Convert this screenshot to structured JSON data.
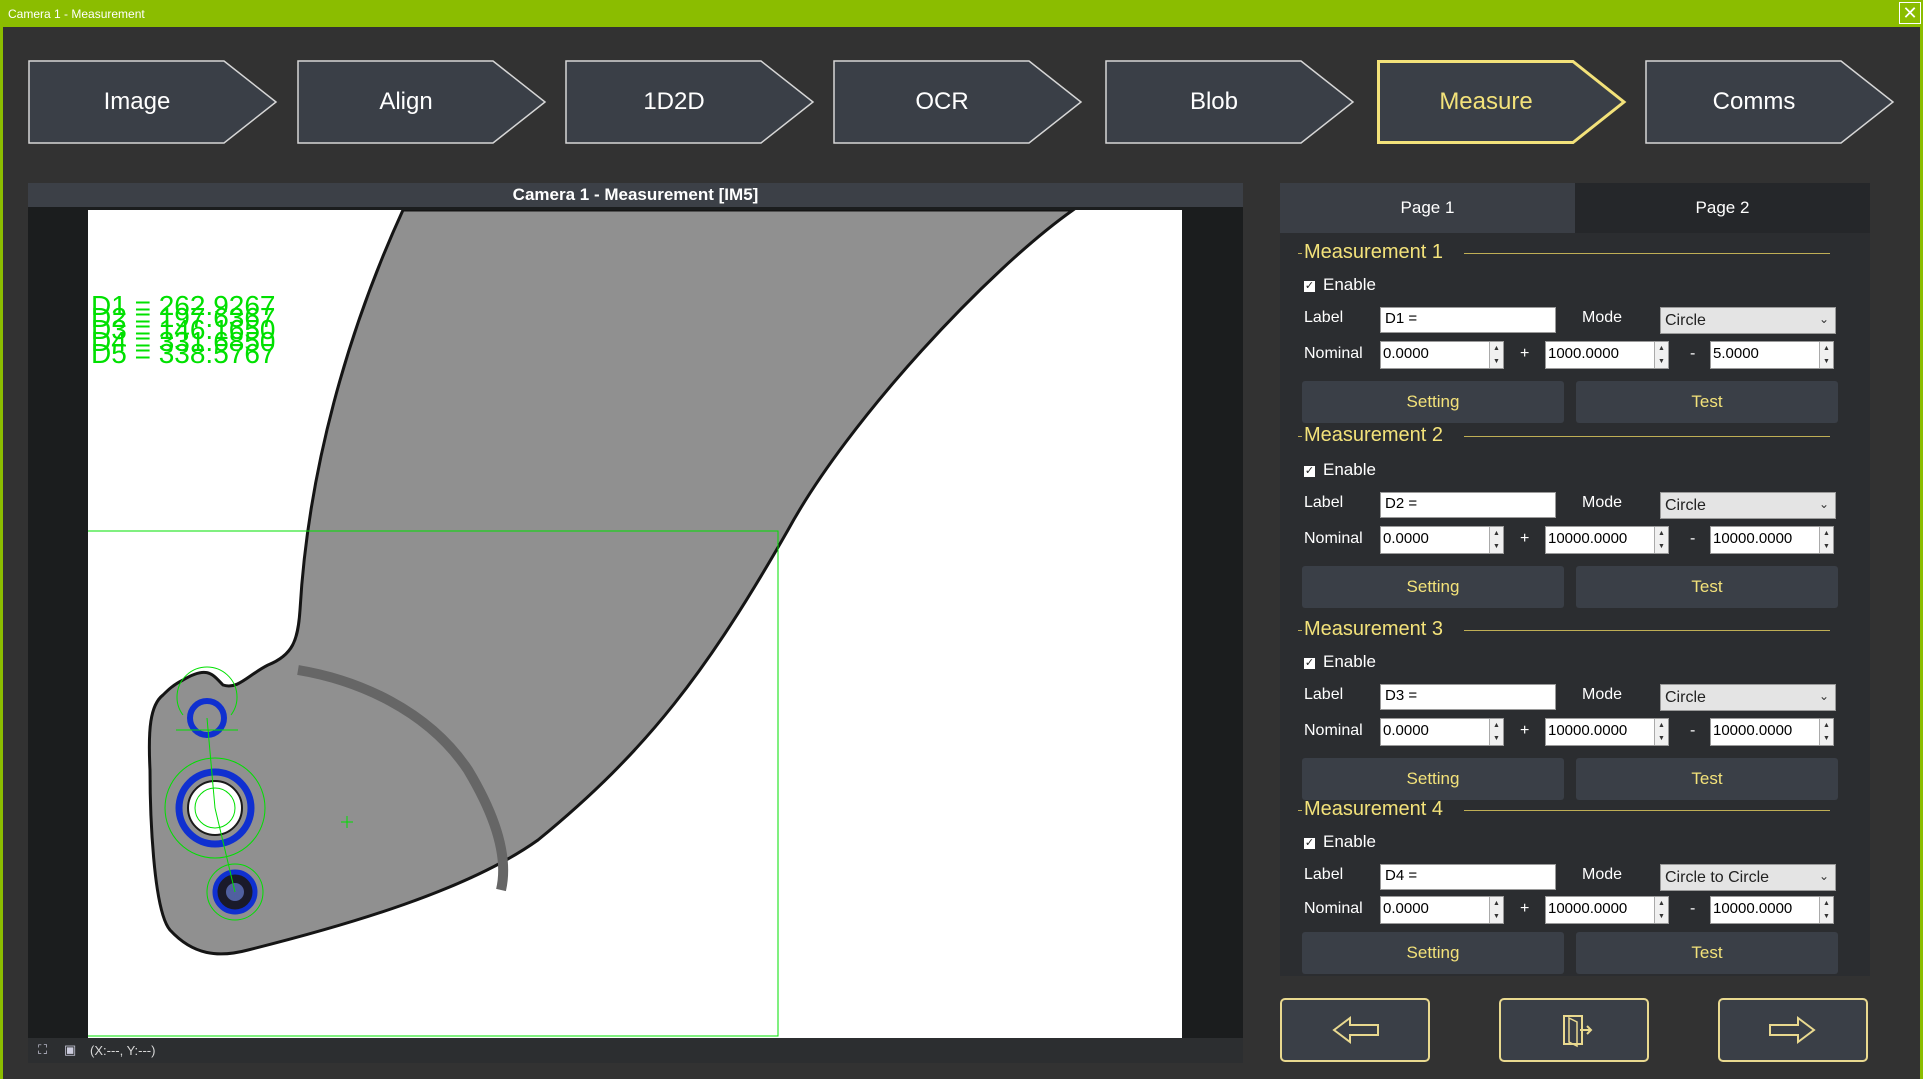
{
  "window": {
    "title": "Camera 1 - Measurement",
    "close_glyph": "✕"
  },
  "steps": [
    {
      "label": "Image",
      "active": false
    },
    {
      "label": "Align",
      "active": false
    },
    {
      "label": "1D2D",
      "active": false
    },
    {
      "label": "OCR",
      "active": false
    },
    {
      "label": "Blob",
      "active": false
    },
    {
      "label": "Measure",
      "active": true
    },
    {
      "label": "Comms",
      "active": false
    }
  ],
  "viewer": {
    "title": "Camera 1 -  Measurement  [IM5]",
    "overlay_results": [
      "D1 = 262.9267",
      "D2 = 197.6367",
      "D3 = 146.1650",
      "D4 = 331.6850",
      "D5 = 338.5767"
    ],
    "coords": "(X:---, Y:---)",
    "status_icons": [
      "fit-icon",
      "image-icon"
    ]
  },
  "panel": {
    "tabs": [
      "Page 1",
      "Page 2"
    ],
    "active_tab": "Page 1",
    "measurements": [
      {
        "title": "Measurement 1",
        "enable_label": "Enable",
        "enabled": true,
        "label_caption": "Label",
        "label_value": "D1 =",
        "mode_caption": "Mode",
        "mode": "Circle",
        "nominal_caption": "Nominal",
        "nominal": "0.0000",
        "plus": "+",
        "plus_tol": "1000.0000",
        "minus": "-",
        "minus_tol": "5.0000",
        "setting": "Setting",
        "test": "Test"
      },
      {
        "title": "Measurement 2",
        "enable_label": "Enable",
        "enabled": true,
        "label_caption": "Label",
        "label_value": "D2 =",
        "mode_caption": "Mode",
        "mode": "Circle",
        "nominal_caption": "Nominal",
        "nominal": "0.0000",
        "plus": "+",
        "plus_tol": "10000.0000",
        "minus": "-",
        "minus_tol": "10000.0000",
        "setting": "Setting",
        "test": "Test"
      },
      {
        "title": "Measurement 3",
        "enable_label": "Enable",
        "enabled": true,
        "label_caption": "Label",
        "label_value": "D3 =",
        "mode_caption": "Mode",
        "mode": "Circle",
        "nominal_caption": "Nominal",
        "nominal": "0.0000",
        "plus": "+",
        "plus_tol": "10000.0000",
        "minus": "-",
        "minus_tol": "10000.0000",
        "setting": "Setting",
        "test": "Test"
      },
      {
        "title": "Measurement 4",
        "enable_label": "Enable",
        "enabled": true,
        "label_caption": "Label",
        "label_value": "D4 =",
        "mode_caption": "Mode",
        "mode": "Circle to Circle",
        "nominal_caption": "Nominal",
        "nominal": "0.0000",
        "plus": "+",
        "plus_tol": "10000.0000",
        "minus": "-",
        "minus_tol": "10000.0000",
        "setting": "Setting",
        "test": "Test"
      }
    ]
  },
  "nav": {
    "icons": [
      "arrow-left-icon",
      "exit-icon",
      "arrow-right-icon"
    ]
  },
  "colors": {
    "accent": "#f3e27a",
    "titlebar": "#8bbd00",
    "overlay_green": "#00e000",
    "overlay_blue": "#1030d0"
  }
}
